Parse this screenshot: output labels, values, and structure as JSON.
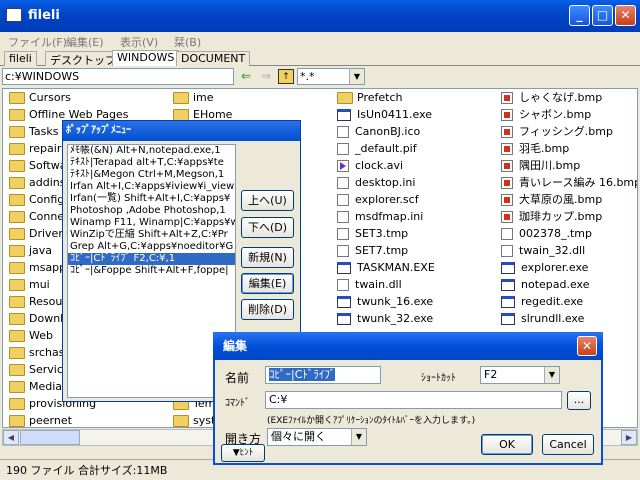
{
  "window": {
    "title": "fileli",
    "minimize": "_",
    "maximize": "□",
    "close": "✕"
  },
  "menu": [
    "ファイル(F)",
    "編集(E)",
    "表示(V)",
    "栞(B)"
  ],
  "tabs": [
    "fileli",
    "デスクトップ",
    "WINDOWS",
    "DOCUMENT"
  ],
  "path": {
    "value": "c:¥WINDOWS",
    "back": "⇐",
    "forward": "⇒",
    "filter": "*.*"
  },
  "files": {
    "col1": [
      "Cursors",
      "Offline Web Pages",
      "Tasks",
      "repair",
      "Software",
      "addins",
      "Config",
      "Connec",
      "Driver",
      "java",
      "msapps",
      "mui",
      "Resour",
      "Downlo",
      "Web",
      "srchass",
      "Service",
      "Media",
      "provisioning",
      "peernet"
    ],
    "col2": [
      "ime",
      "EHome",
      "Temp",
      "system"
    ],
    "col3": [
      "Prefetch",
      "IsUn0411.exe",
      "CanonBJ.ico",
      "_default.pif",
      "clock.avi",
      "desktop.ini",
      "explorer.scf",
      "msdfmap.ini",
      "SET3.tmp",
      "SET7.tmp",
      "TASKMAN.EXE",
      "twain.dll",
      "twunk_16.exe",
      "twunk_32.exe"
    ],
    "col4": [
      "しゃくなげ.bmp",
      "シャボン.bmp",
      "フィッシング.bmp",
      "羽毛.bmp",
      "隅田川.bmp",
      "青いレース編み 16.bmp",
      "大草原の風.bmp",
      "珈琲カップ.bmp",
      "002378_.tmp",
      "twain_32.dll",
      "explorer.exe",
      "notepad.exe",
      "regedit.exe",
      "slrundll.exe"
    ]
  },
  "status": "190 ファイル 合計サイズ:11MB",
  "popup": {
    "title": "ﾎﾟｯﾌﾟｱｯﾌﾟﾒﾆｭｰ",
    "items": [
      "ﾒﾓ帳(&N) Alt+N,notepad.exe,1",
      "ﾃｷｽﾄ|Terapad alt+T,C:¥apps¥te",
      "ﾃｷｽﾄ|&Megon Ctrl+M,Megson,1",
      "Irfan Alt+I,C:¥apps¥iview¥i_view",
      "Irfan(一覧) Shift+Alt+I,C:¥apps¥",
      "Photoshop ,Adobe Photoshop,1",
      "Winamp F11, Winamp|C:¥apps¥w",
      "WinZipで圧縮 Shift+Alt+Z,C:¥Pr",
      "Grep Alt+G,C:¥apps¥noeditor¥G",
      "ｺﾋﾟｰ|Cﾄﾞﾗｲﾌﾞ F2,C:¥,1",
      "ｺﾋﾟｰ|&Foppe Shift+Alt+F,foppe|"
    ],
    "buttons": [
      "上へ(U)",
      "下へ(D)",
      "新規(N)",
      "編集(E)",
      "削除(D)"
    ]
  },
  "dialog": {
    "title": "編集",
    "name_label": "名前",
    "name_value": "ｺﾋﾟｰ|Cﾄﾞﾗｲﾌﾞ",
    "shortcut_label": "ｼｮｰﾄｶｯﾄ",
    "shortcut_value": "F2",
    "command_label": "ｺﾏﾝﾄﾞ",
    "command_value": "C:¥",
    "browse": "...",
    "hint": "(EXEﾌｧｲﾙか開くｱﾌﾟﾘｹｰｼｮﾝのﾀｲﾄﾙﾊﾞｰを入力します。)",
    "open_label": "開き方",
    "open_value": "個々に開く",
    "toggle_hint": "▼ﾋﾝﾄ",
    "ok": "OK",
    "cancel": "Cancel"
  }
}
